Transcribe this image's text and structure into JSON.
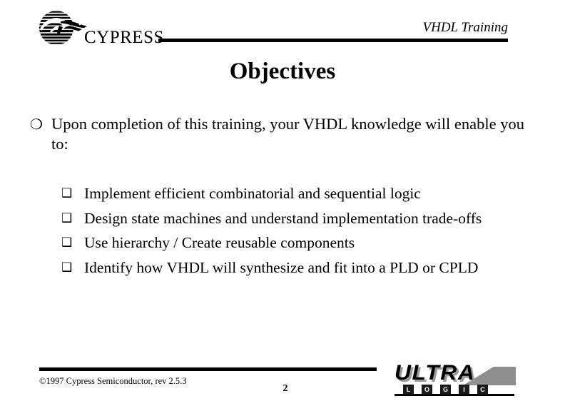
{
  "header": {
    "brand": "CYPRESS",
    "brand_icon": "cypress-globe-bird-logo",
    "title": "VHDL Training"
  },
  "slide": {
    "title": "Objectives",
    "bullets": [
      {
        "marker": "❍",
        "marker_name": "hollow-circle-bullet",
        "text": "Upon completion of this training, your VHDL knowledge will enable you to:"
      }
    ],
    "sub_bullets": [
      {
        "marker": "❑",
        "marker_name": "hollow-square-bullet",
        "text": "Implement efficient combinatorial and sequential logic"
      },
      {
        "marker": "❑",
        "marker_name": "hollow-square-bullet",
        "text": "Design state machines and understand implementation trade-offs"
      },
      {
        "marker": "❑",
        "marker_name": "hollow-square-bullet",
        "text": "Use hierarchy / Create reusable components"
      },
      {
        "marker": "❑",
        "marker_name": "hollow-square-bullet",
        "text": "Identify how VHDL will synthesize and fit into a PLD or CPLD"
      }
    ]
  },
  "footer": {
    "copyright": "©1997 Cypress Semiconductor, rev 2.5.3",
    "page_number": "2",
    "logo": {
      "word": "ULTRA",
      "sub_letters": [
        "L",
        "O",
        "G",
        "I",
        "C"
      ]
    }
  },
  "colors": {
    "ink": "#000000",
    "page": "#ffffff",
    "logo_shadow": "#9a9a9a"
  }
}
